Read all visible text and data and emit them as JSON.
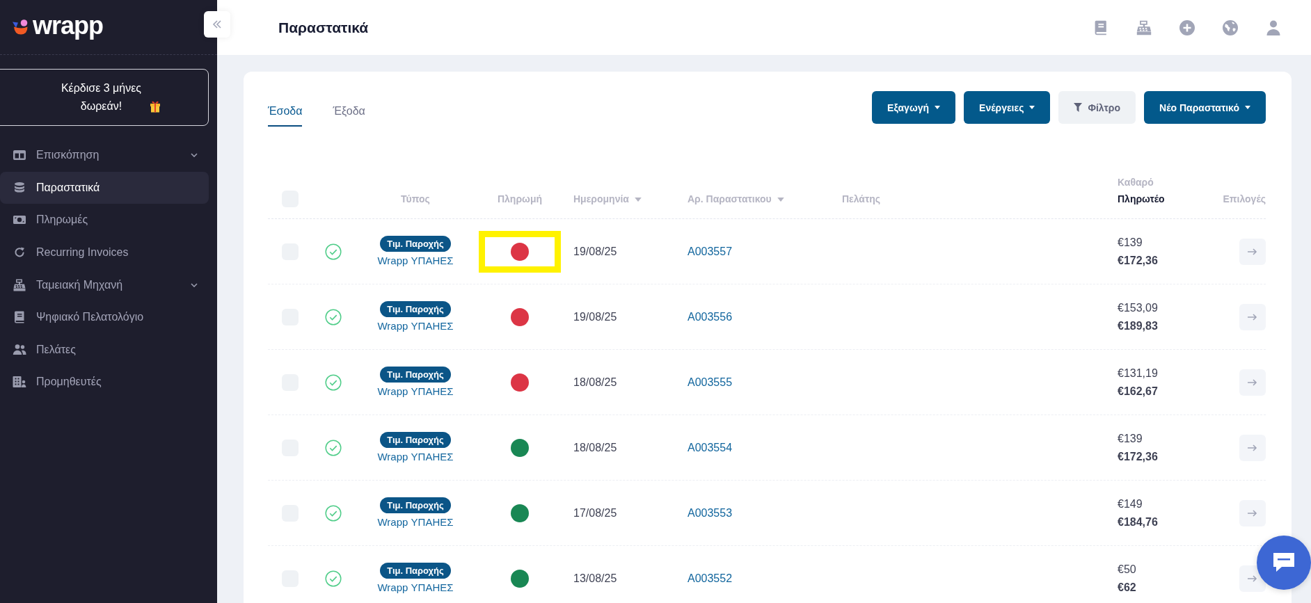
{
  "sidebar": {
    "logo": "wrapp",
    "promo": {
      "text": "Κέρδισε 3 μήνες δωρεάν!"
    },
    "items": [
      {
        "label": "Επισκόπηση",
        "kind": "group",
        "selected": false
      },
      {
        "label": "Παραστατικά",
        "kind": "link",
        "selected": true
      },
      {
        "label": "Πληρωμές",
        "kind": "link",
        "selected": false
      },
      {
        "label": "Recurring Invoices",
        "kind": "link",
        "selected": false
      },
      {
        "label": "Ταμειακή Μηχανή",
        "kind": "group",
        "selected": false
      },
      {
        "label": "Ψηφιακό Πελατολόγιο",
        "kind": "link",
        "selected": false
      },
      {
        "label": "Πελάτες",
        "kind": "link",
        "selected": false
      },
      {
        "label": "Προμηθευτές",
        "kind": "link",
        "selected": false
      }
    ]
  },
  "header": {
    "title": "Παραστατικά"
  },
  "tabs": [
    {
      "label": "Έσοδα",
      "selected": true
    },
    {
      "label": "Έξοδα",
      "selected": false
    }
  ],
  "actions": [
    {
      "label": "Εξαγωγή",
      "kind": "menu"
    },
    {
      "label": "Ενέργειες",
      "kind": "menu"
    },
    {
      "label": "Φίλτρο",
      "kind": "filter"
    },
    {
      "label": "Νέο Παραστατικό",
      "kind": "menu"
    }
  ],
  "table": {
    "select_all": {
      "checked": false
    },
    "columns": [
      {
        "label": "Τύπος",
        "sortable": false
      },
      {
        "label": "Πληρωμή",
        "sortable": false
      },
      {
        "label": "Ημερομηνία",
        "sortable": true
      },
      {
        "label": "Αρ. Παραστατικου",
        "sortable": true
      },
      {
        "label": "Πελάτης",
        "sortable": false
      },
      {
        "label": "Καθαρό",
        "sublabel": "Πληρωτέο",
        "sortable": false
      },
      {
        "label": "Επιλογές",
        "sortable": false
      }
    ],
    "rows": [
      {
        "checked": false,
        "valid": true,
        "type": "Τιμ. Παροχής",
        "series": "Wrapp ΥΠΑΗΕΣ",
        "color": "#dc3545",
        "highlighted": true,
        "date": "19/08/25",
        "number": "A003557",
        "net": "€139",
        "payable": "€172,36"
      },
      {
        "checked": false,
        "valid": true,
        "type": "Τιμ. Παροχής",
        "series": "Wrapp ΥΠΑΗΕΣ",
        "color": "#dc3545",
        "highlighted": false,
        "date": "19/08/25",
        "number": "A003556",
        "net": "€153,09",
        "payable": "€189,83"
      },
      {
        "checked": false,
        "valid": true,
        "type": "Τιμ. Παροχής",
        "series": "Wrapp ΥΠΑΗΕΣ",
        "color": "#dc3545",
        "highlighted": false,
        "date": "18/08/25",
        "number": "A003555",
        "net": "€131,19",
        "payable": "€162,67"
      },
      {
        "checked": false,
        "valid": true,
        "type": "Τιμ. Παροχής",
        "series": "Wrapp ΥΠΑΗΕΣ",
        "color": "#198754",
        "highlighted": false,
        "date": "18/08/25",
        "number": "A003554",
        "net": "€139",
        "payable": "€172,36"
      },
      {
        "checked": false,
        "valid": true,
        "type": "Τιμ. Παροχής",
        "series": "Wrapp ΥΠΑΗΕΣ",
        "color": "#198754",
        "highlighted": false,
        "date": "17/08/25",
        "number": "A003553",
        "net": "€149",
        "payable": "€184,76"
      },
      {
        "checked": false,
        "valid": true,
        "type": "Τιμ. Παροχής",
        "series": "Wrapp ΥΠΑΗΕΣ",
        "color": "#198754",
        "highlighted": false,
        "date": "13/08/25",
        "number": "A003552",
        "net": "€50",
        "payable": "€62"
      }
    ]
  }
}
